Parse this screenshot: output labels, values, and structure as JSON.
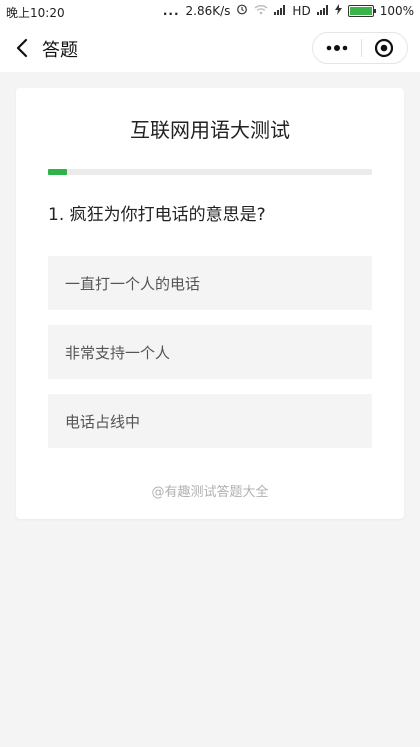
{
  "status_bar": {
    "time": "晚上10:20",
    "dots": "...",
    "net_speed": "2.86K/s",
    "network_label": "HD",
    "battery": "100%"
  },
  "nav": {
    "title": "答题"
  },
  "quiz": {
    "title": "互联网用语大测试",
    "progress_fraction": 0.06,
    "question": "1. 疯狂为你打电话的意思是?",
    "options": [
      {
        "label": "一直打一个人的电话"
      },
      {
        "label": "非常支持一个人"
      },
      {
        "label": "电话占线中"
      }
    ],
    "footer": "@有趣测试答题大全"
  },
  "colors": {
    "accent": "#2db34a",
    "page_bg": "#f4f4f4",
    "card_bg": "#ffffff",
    "option_bg": "#f4f4f4"
  },
  "icons": {
    "back": "chevron-left-icon",
    "more": "more-dots-icon",
    "close": "target-circle-icon",
    "alarm": "alarm-icon",
    "wifi": "wifi-icon",
    "signal": "signal-icon",
    "charging": "charging-bolt-icon",
    "battery": "battery-icon"
  }
}
